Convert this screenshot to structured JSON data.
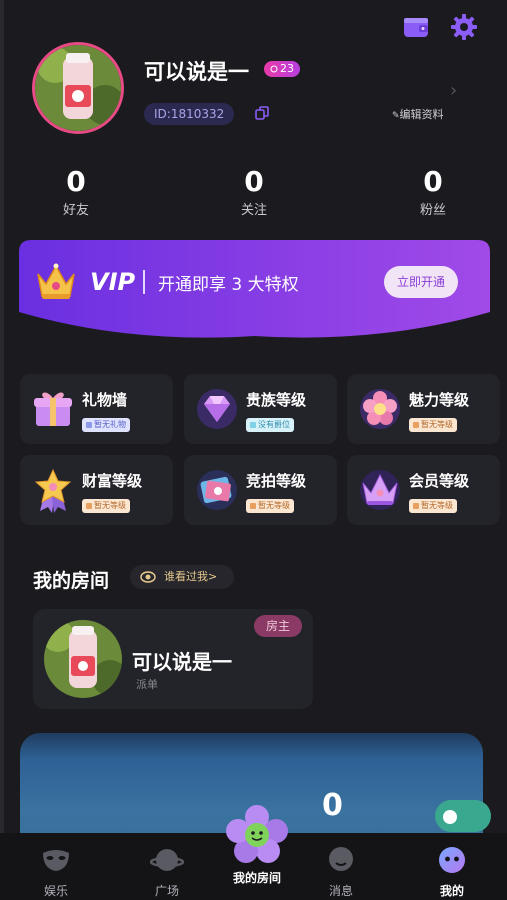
{
  "profile": {
    "name": "可以说是一",
    "level": "23",
    "id": "ID:1810332",
    "edit_label": "编辑资料"
  },
  "stats": [
    {
      "value": "0",
      "label": "好友"
    },
    {
      "value": "0",
      "label": "关注"
    },
    {
      "value": "0",
      "label": "粉丝"
    }
  ],
  "vip": {
    "title": "VIP",
    "subtitle": "开通即享 3 大特权",
    "button": "立即开通"
  },
  "features": [
    {
      "title": "礼物墙",
      "badge": "暂无礼物",
      "badge_color": "#8e9be8",
      "icon": "gift-box-icon"
    },
    {
      "title": "贵族等级",
      "badge": "没有爵位",
      "badge_color": "#7fd1e6",
      "icon": "diamond-icon"
    },
    {
      "title": "魅力等级",
      "badge": "暂无等级",
      "badge_color": "#f2c8a0",
      "icon": "flower-icon"
    },
    {
      "title": "财富等级",
      "badge": "暂无等级",
      "badge_color": "#f2c8a0",
      "icon": "star-medal-icon"
    },
    {
      "title": "竞拍等级",
      "badge": "暂无等级",
      "badge_color": "#f2c8a0",
      "icon": "auction-card-icon"
    },
    {
      "title": "会员等级",
      "badge": "暂无等级",
      "badge_color": "#f2c8a0",
      "icon": "crown-icon"
    }
  ],
  "my_room": {
    "section_title": "我的房间",
    "who_viewed": "谁看过我>",
    "room_name": "可以说是一",
    "room_sub": "派单",
    "owner_badge": "房主"
  },
  "big_card": {
    "value": "0"
  },
  "tabs": [
    {
      "label": "娱乐",
      "icon": "mask-icon"
    },
    {
      "label": "广场",
      "icon": "planet-icon"
    },
    {
      "label": "我的房间",
      "icon": "flower-mascot-icon"
    },
    {
      "label": "消息",
      "icon": "chat-bubble-icon"
    },
    {
      "label": "我的",
      "icon": "face-icon"
    }
  ],
  "colors": {
    "accent": "#7b3fe4",
    "vip_gradient_start": "#6a2fe0",
    "vip_gradient_end": "#a14ae8",
    "background": "#1b1b1f"
  }
}
